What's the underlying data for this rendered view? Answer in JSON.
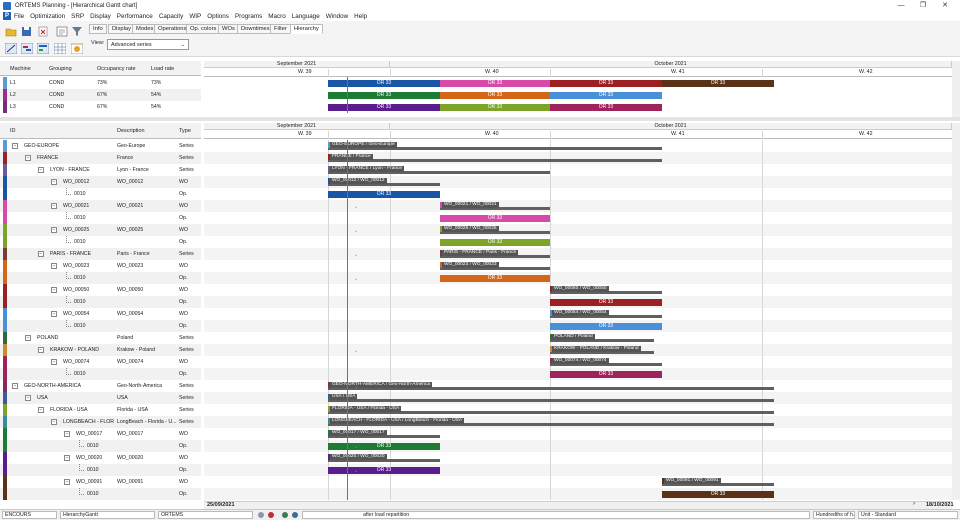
{
  "window": {
    "title": "ORTEMS  Planning - [Hierarchical Gantt chart]",
    "minimize": "—",
    "restore": "❐",
    "close": "✕"
  },
  "menu": [
    "File",
    "Optimization",
    "SRP",
    "Display",
    "Performance",
    "Capacity",
    "WIP",
    "Options",
    "Programs",
    "Macro",
    "Language",
    "Window",
    "Help"
  ],
  "tabs": [
    "Info",
    "Display",
    "Modes",
    "Operations",
    "Op. colors",
    "WOs",
    "Downtimes",
    "Filter",
    "Hierarchy"
  ],
  "active_tab": "Hierarchy",
  "view": {
    "label": "View:",
    "value": "Advanced series"
  },
  "timeline": {
    "months": [
      {
        "label": "September 2021"
      },
      {
        "label": "October 2021"
      }
    ],
    "weeks": [
      "W. 39",
      "W. 40",
      "W. 41",
      "W. 42"
    ]
  },
  "machines": {
    "headers": [
      "Machine",
      "Grouping",
      "Occupancy rate",
      "Load rate"
    ],
    "rows": [
      {
        "machine": "L1",
        "grouping": "COND",
        "occupancy": "73%",
        "load": "73%",
        "color": "#5b9bd5"
      },
      {
        "machine": "L2",
        "grouping": "COND",
        "occupancy": "67%",
        "load": "54%",
        "color": "#9b2d8e"
      },
      {
        "machine": "L3",
        "grouping": "COND",
        "occupancy": "67%",
        "load": "54%",
        "color": "#7a2a7a"
      }
    ]
  },
  "machine_bars": [
    [
      {
        "label": "OR 33",
        "color": "#1a56a6"
      },
      {
        "label": "OR 33",
        "color": "#d94aa8"
      },
      {
        "label": "OR 33",
        "color": "#9c1f24"
      },
      {
        "label": "OR 33",
        "color": "#5a3218"
      }
    ],
    [
      {
        "label": "OR 33",
        "color": "#1e7b34"
      },
      {
        "label": "OR 33",
        "color": "#d4661a"
      },
      {
        "label": "OR 33",
        "color": "#4a90d9"
      }
    ],
    [
      {
        "label": "OR 33",
        "color": "#5a1d8e"
      },
      {
        "label": "OR 33",
        "color": "#7da328"
      },
      {
        "label": "OR 33",
        "color": "#a0225a"
      }
    ]
  ],
  "tree": {
    "headers": [
      "ID",
      "Description",
      "Type"
    ],
    "rows": [
      {
        "id": "GEO-EUROPE",
        "desc": "Geo-Europe",
        "type": "Series",
        "color": "#5b9bd5",
        "expander": "−",
        "gantt": "GEO-EUROPE / Geo-Europe"
      },
      {
        "id": "FRANCE",
        "desc": "France",
        "type": "Series",
        "color": "#9c1f24",
        "expander": "−",
        "gantt": "FRANCE / France"
      },
      {
        "id": "LYON - FRANCE",
        "desc": "Lyon - France",
        "type": "Series",
        "color": "#6b5b9b",
        "expander": "−",
        "gantt": "LYON - FRANCE / Lyon - France"
      },
      {
        "id": "WO_00012",
        "desc": "WO_00012",
        "type": "WO",
        "color": "#1a56a6",
        "expander": "−",
        "gantt": "WO_00012 / WO_00012"
      },
      {
        "id": "0010",
        "desc": "",
        "type": "Op.",
        "color": "#1a56a6",
        "expander": "",
        "gantt": "OR 33"
      },
      {
        "id": "WO_00021",
        "desc": "WO_00021",
        "type": "WO",
        "color": "#d94aa8",
        "expander": "−",
        "gantt": "WO_00021 / WO_00021"
      },
      {
        "id": "0010",
        "desc": "",
        "type": "Op.",
        "color": "#d94aa8",
        "expander": "",
        "gantt": "OR 33"
      },
      {
        "id": "WO_00025",
        "desc": "WO_00025",
        "type": "WO",
        "color": "#7da328",
        "expander": "−",
        "gantt": "WO_00025 / WO_00025"
      },
      {
        "id": "0010",
        "desc": "",
        "type": "Op.",
        "color": "#7da328",
        "expander": "",
        "gantt": "OR 33"
      },
      {
        "id": "PARIS - FRANCE",
        "desc": "Paris - France",
        "type": "Series",
        "color": "#7a3a3a",
        "expander": "−",
        "gantt": "PARIS - FRANCE / Paris - France"
      },
      {
        "id": "WO_00023",
        "desc": "WO_00023",
        "type": "WO",
        "color": "#d4661a",
        "expander": "−",
        "gantt": "WO_00023 / WO_00023"
      },
      {
        "id": "0010",
        "desc": "",
        "type": "Op.",
        "color": "#d4661a",
        "expander": "",
        "gantt": "OR 33"
      },
      {
        "id": "WO_00050",
        "desc": "WO_00050",
        "type": "WO",
        "color": "#9c1f24",
        "expander": "−",
        "gantt": "WO_00050 / WO_00050"
      },
      {
        "id": "0010",
        "desc": "",
        "type": "Op.",
        "color": "#9c1f24",
        "expander": "",
        "gantt": "OR 33"
      },
      {
        "id": "WO_00054",
        "desc": "WO_00054",
        "type": "WO",
        "color": "#4a90d9",
        "expander": "−",
        "gantt": "WO_00054 / WO_00054"
      },
      {
        "id": "0010",
        "desc": "",
        "type": "Op.",
        "color": "#4a90d9",
        "expander": "",
        "gantt": "OR 33"
      },
      {
        "id": "POLAND",
        "desc": "Poland",
        "type": "Series",
        "color": "#2e6b3a",
        "expander": "−",
        "gantt": "POLAND / Poland"
      },
      {
        "id": "KRAKOW - POLAND",
        "desc": "Krakow - Poland",
        "type": "Series",
        "color": "#c98a2a",
        "expander": "−",
        "gantt": "KRAKOW - POLAND / Krakow - Poland"
      },
      {
        "id": "WO_00074",
        "desc": "WO_00074",
        "type": "WO",
        "color": "#a0225a",
        "expander": "−",
        "gantt": "WO_00074 / WO_00074"
      },
      {
        "id": "0010",
        "desc": "",
        "type": "Op.",
        "color": "#a0225a",
        "expander": "",
        "gantt": "OR 33"
      },
      {
        "id": "GEO-NORTH-AMERICA",
        "desc": "Geo-North-America",
        "type": "Series",
        "color": "#8a2a5a",
        "expander": "−",
        "gantt": "GEO-NORTH-AMERICA / Geo-North-America"
      },
      {
        "id": "USA",
        "desc": "USA",
        "type": "Series",
        "color": "#3a5a9a",
        "expander": "−",
        "gantt": "USA / USA"
      },
      {
        "id": "FLORIDA - USA",
        "desc": "Florida - USA",
        "type": "Series",
        "color": "#7da328",
        "expander": "−",
        "gantt": "FLORIDA - USA / Florida - USA"
      },
      {
        "id": "LONGBEACH - FLORI",
        "desc": "LongBeach - Florida - U...",
        "type": "Series",
        "color": "#3a8a9a",
        "expander": "−",
        "gantt": "LONGBEACH - FLORIDA - USA / LongBeach - Florida - USA"
      },
      {
        "id": "WO_00017",
        "desc": "WO_00017",
        "type": "WO",
        "color": "#1e7b34",
        "expander": "−",
        "gantt": "WO_00017 / WO_00017"
      },
      {
        "id": "0010",
        "desc": "",
        "type": "Op.",
        "color": "#1e7b34",
        "expander": "",
        "gantt": "OR 33"
      },
      {
        "id": "WO_00020",
        "desc": "WO_00020",
        "type": "WO",
        "color": "#5a1d8e",
        "expander": "−",
        "gantt": "WO_00020 / WO_00020"
      },
      {
        "id": "0010",
        "desc": "",
        "type": "Op.",
        "color": "#5a1d8e",
        "expander": "",
        "gantt": "OR 33"
      },
      {
        "id": "WO_00091",
        "desc": "WO_00091",
        "type": "WO",
        "color": "#5a3218",
        "expander": "−",
        "gantt": "WO_00091 / WO_00091"
      },
      {
        "id": "0010",
        "desc": "",
        "type": "Op.",
        "color": "#5a3218",
        "expander": "",
        "gantt": "OR 33"
      }
    ]
  },
  "dates": {
    "start": "25/09/2021",
    "end": "18/10/2021"
  },
  "status": {
    "mode": "ENCOURS",
    "chart": "HierarchyGantt",
    "app": "ORTEMS",
    "message": "after load repartition",
    "units": "Hundredths of h.",
    "unit_std": "Unit - Standard"
  }
}
